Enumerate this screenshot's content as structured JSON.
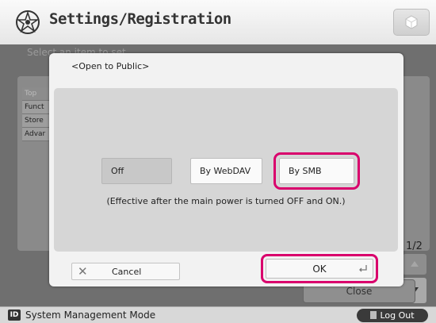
{
  "header": {
    "title": "Settings/Registration",
    "icons": {
      "settings": "settings-icon",
      "cube": "cube-icon"
    }
  },
  "background": {
    "instruction": "Select an item to set.",
    "list_items": [
      "Top",
      "Funct",
      "Store",
      "Advar"
    ],
    "page_indicator": "1/2",
    "close_label": "Close"
  },
  "dialog": {
    "title": "<Open to Public>",
    "options": {
      "off": "Off",
      "webdav": "By WebDAV",
      "smb": "By SMB",
      "selected": "By SMB"
    },
    "note": "(Effective after the main power is turned OFF and ON.)",
    "cancel_label": "Cancel",
    "ok_label": "OK"
  },
  "statusbar": {
    "mode_icon_text": "ID",
    "mode": "System Management Mode",
    "logout_label": "Log Out"
  },
  "colors": {
    "highlight": "#d9006c",
    "background_dim": "#6f6f6f",
    "dialog_bg": "#f2f2f2"
  }
}
